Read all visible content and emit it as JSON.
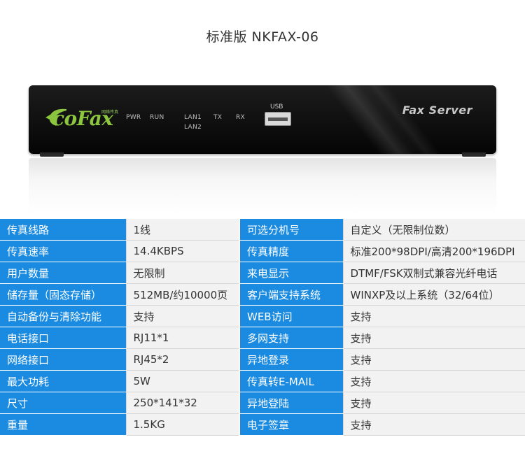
{
  "title": "标准版 NKFAX-06",
  "device": {
    "logo": "coFax",
    "logo_sub": "网络传真",
    "leds": [
      "PWR",
      "RUN",
      "LAN1",
      "LAN2",
      "TX",
      "RX"
    ],
    "usb_label": "USB",
    "brand_label": "Fax Server"
  },
  "specs": [
    {
      "k1": "传真线路",
      "v1": "1线",
      "k2": "可选分机号",
      "v2": "自定义（无限制位数）"
    },
    {
      "k1": "传真速率",
      "v1": "14.4KBPS",
      "k2": "传真精度",
      "v2": "标准200*98DPI/高清200*196DPI"
    },
    {
      "k1": "用户数量",
      "v1": "无限制",
      "k2": "来电显示",
      "v2": "DTMF/FSK双制式兼容光纤电话"
    },
    {
      "k1": "储存量（固态存储）",
      "v1": "512MB/约10000页",
      "k2": "客户端支持系统",
      "v2": "WINXP及以上系统（32/64位）"
    },
    {
      "k1": "自动备份与清除功能",
      "v1": "支持",
      "k2": "WEB访问",
      "v2": "支持"
    },
    {
      "k1": "电话接口",
      "v1": "RJ11*1",
      "k2": "多网支持",
      "v2": "支持"
    },
    {
      "k1": "网络接口",
      "v1": "RJ45*2",
      "k2": "异地登录",
      "v2": "支持"
    },
    {
      "k1": "最大功耗",
      "v1": "5W",
      "k2": "传真转E-MAIL",
      "v2": "支持"
    },
    {
      "k1": "尺寸",
      "v1": "250*141*32",
      "k2": "异地登陆",
      "v2": "支持"
    },
    {
      "k1": "重量",
      "v1": "1.5KG",
      "k2": "电子签章",
      "v2": "支持"
    }
  ]
}
